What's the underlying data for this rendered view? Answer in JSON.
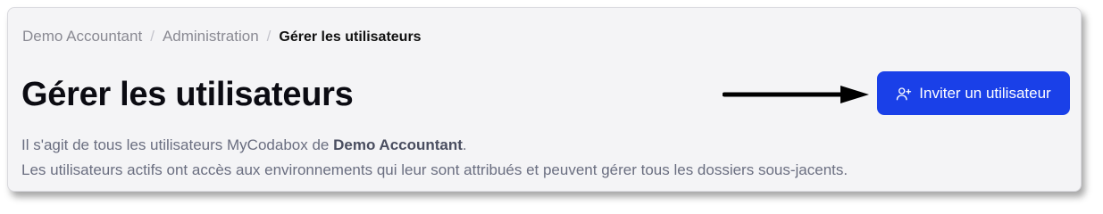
{
  "breadcrumb": {
    "items": [
      "Demo Accountant",
      "Administration"
    ],
    "separator": "/",
    "current": "Gérer les utilisateurs"
  },
  "page": {
    "title": "Gérer les utilisateurs"
  },
  "actions": {
    "invite_label": "Inviter un utilisateur",
    "invite_icon": "user-plus-icon",
    "accent_color": "#1a40e8"
  },
  "description": {
    "line1_prefix": "Il s'agit de tous les utilisateurs MyCodabox de ",
    "line1_company": "Demo Accountant",
    "line1_suffix": ".",
    "line2": "Les utilisateurs actifs ont accès aux environnements qui leur sont attribués et peuvent gérer tous les dossiers sous-jacents."
  }
}
